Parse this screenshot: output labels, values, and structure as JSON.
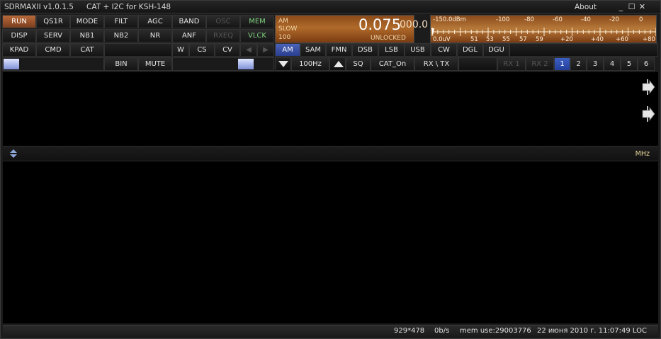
{
  "titlebar": {
    "app": "SDRMAXII v1.0.1.5",
    "cat": "CAT  + I2C for  KSH-148",
    "about": "About",
    "minimize": "_",
    "maximize": "☐",
    "close": "✕"
  },
  "row1": {
    "run": "RUN",
    "qs1r": "QS1R",
    "mode": "MODE",
    "filt": "FILT",
    "agc": "AGC",
    "band": "BAND",
    "osc": "OSC",
    "mem": "MEM"
  },
  "row2": {
    "disp": "DISP",
    "serv": "SERV",
    "nb1": "NB1",
    "nb2": "NB2",
    "nr": "NR",
    "anf": "ANF",
    "rxeq": "RXEQ",
    "vlck": "VLCK"
  },
  "row3": {
    "kpad": "KPAD",
    "cmd": "CMD",
    "cat": "CAT",
    "w": "W",
    "cs": "CS",
    "cv": "CV",
    "prev": "◀",
    "next": "▶"
  },
  "row4": {
    "bin": "BIN",
    "mute": "MUTE"
  },
  "display": {
    "mode": "AM",
    "agc": "SLOW",
    "step": "100",
    "freq": "0.075",
    "freq_sub": "000.0",
    "lock": "UNLOCKED"
  },
  "smeter": {
    "top_labels": [
      "-150.0dBm",
      "-100",
      "-80",
      "-60",
      "-40",
      "-20",
      "0"
    ],
    "bottom_labels": [
      "0.0uV",
      "51",
      "53",
      "55",
      "57",
      "59",
      "+20",
      "+40",
      "+60",
      "+80"
    ]
  },
  "modes": [
    "AM",
    "SAM",
    "FMN",
    "DSB",
    "LSB",
    "USB",
    "CW",
    "DGL",
    "DGU"
  ],
  "active_mode": "AM",
  "row4_right": {
    "step": "100Hz",
    "sq": "SQ",
    "cat_on": "CAT_On",
    "rxtx": "RX \\ TX"
  },
  "rx": [
    "RX 1",
    "RX 2"
  ],
  "channels": [
    "1",
    "2",
    "3",
    "4",
    "5",
    "6"
  ],
  "active_channel": "1",
  "scale": {
    "unit": "MHz"
  },
  "status": {
    "size": "929*478",
    "rate": "0b/s",
    "mem": "mem use:29003776",
    "datetime": "22 июня 2010 г. 11:07:49 LOC"
  },
  "colors": {
    "run": "#b8693a",
    "active_mode": "#4b63b8",
    "display": "#b06a2a",
    "green_text": "#7fd17f",
    "mhz_text": "#e8d79a"
  }
}
